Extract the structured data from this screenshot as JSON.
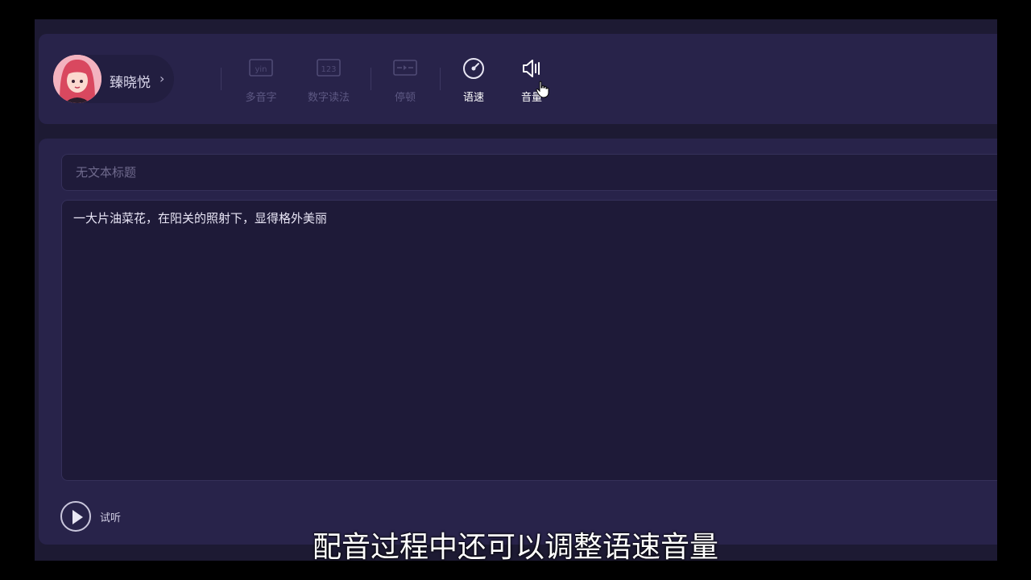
{
  "profile": {
    "name": "臻晓悦",
    "chevron": "›"
  },
  "toolbar": {
    "tools": [
      {
        "label": "多音字",
        "icon": "pinyin-icon",
        "enabled": false
      },
      {
        "label": "数字读法",
        "icon": "number-reading-icon",
        "enabled": false
      },
      {
        "label": "停顿",
        "icon": "pause-insert-icon",
        "enabled": false
      },
      {
        "label": "语速",
        "icon": "speed-gauge-icon",
        "enabled": true
      },
      {
        "label": "音量",
        "icon": "volume-icon",
        "enabled": true
      }
    ]
  },
  "editor": {
    "title_placeholder": "无文本标题",
    "body_text": "一大片油菜花，在阳关的照射下，显得格外美丽"
  },
  "preview": {
    "label": "试听"
  },
  "subtitle": "配音过程中还可以调整语速音量",
  "colors": {
    "background": "#1d1a33",
    "panel": "#28234a",
    "disabled_text": "#5d5883",
    "active_text": "#ffffff"
  }
}
